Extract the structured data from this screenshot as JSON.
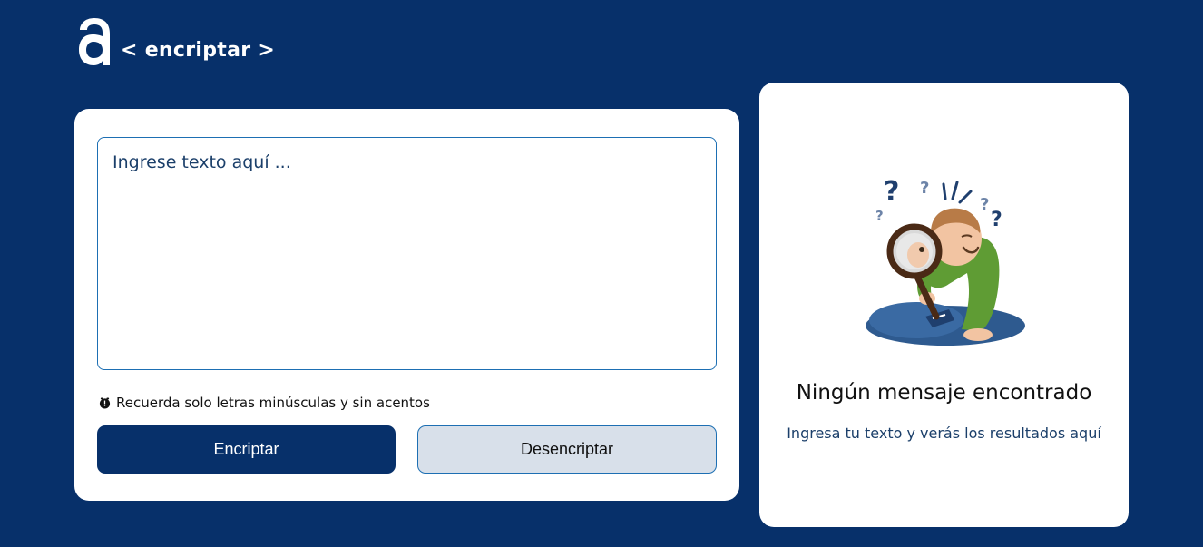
{
  "header": {
    "logo_icon": "alura-logo-icon",
    "brand_text": "< encriptar >"
  },
  "input": {
    "placeholder": "Ingrese texto aquí ...",
    "value": ""
  },
  "hint": {
    "icon": "alert-circle-icon",
    "text": "Recuerda solo letras minúsculas y sin acentos"
  },
  "buttons": {
    "encrypt_label": "Encriptar",
    "decrypt_label": "Desencriptar"
  },
  "output": {
    "illustration": "boy-with-magnifying-glass-illustration",
    "title": "Ningún mensaje encontrado",
    "subtitle": "Ingresa tu texto y verás los resultados aquí"
  },
  "colors": {
    "background": "#07306a",
    "card": "#ffffff",
    "primary_button": "#07306a",
    "secondary_button": "#d8e0ea",
    "border_accent": "#1d6fb3"
  }
}
